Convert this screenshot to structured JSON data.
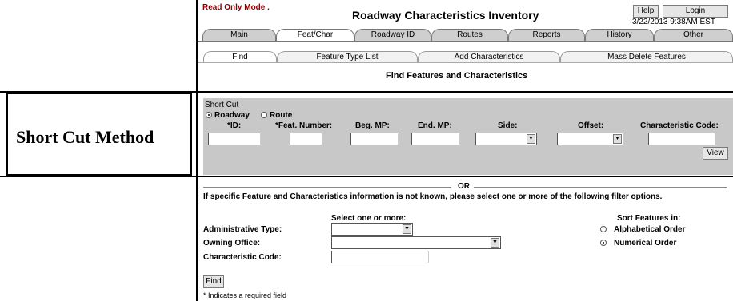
{
  "annotation": {
    "label": "Short Cut Method"
  },
  "header": {
    "mode": "Read Only Mode .",
    "title": "Roadway Characteristics Inventory",
    "help": "Help",
    "login": "Login",
    "datetime": "3/22/2013  9:38AM EST"
  },
  "tabs": [
    "Main",
    "Feat/Char",
    "Roadway ID",
    "Routes",
    "Reports",
    "History",
    "Other"
  ],
  "subtabs": [
    "Find",
    "Feature Type List",
    "Add Characteristics",
    "Mass Delete Features"
  ],
  "page_heading": "Find Features and Characteristics",
  "shortcut": {
    "caption": "Short Cut",
    "radio_roadway": "Roadway",
    "radio_route": "Route",
    "labels": {
      "id": "*ID:",
      "feat_number": "*Feat. Number:",
      "beg_mp": "Beg. MP:",
      "end_mp": "End. MP:",
      "side": "Side:",
      "offset": "Offset:",
      "char_code": "Characteristic Code:"
    },
    "view": "View"
  },
  "or_text": "OR",
  "filter": {
    "note": "If specific Feature and Characteristics information is not known, please select one or more of the following filter options.",
    "select_header": "Select one or more:",
    "admin_type": "Administrative Type:",
    "owning_office": "Owning Office:",
    "char_code": "Characteristic Code:",
    "sort_header": "Sort Features in:",
    "alpha": "Alphabetical Order",
    "numeric": "Numerical Order",
    "find": "Find",
    "required_note": "* Indicates a required field"
  },
  "colors": {
    "read_only": "#8b0000",
    "panel_gray": "#c8c8c8"
  }
}
